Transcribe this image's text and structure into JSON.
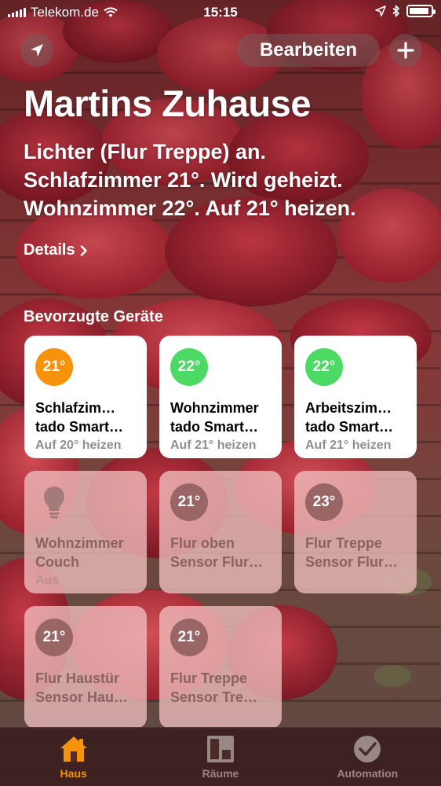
{
  "status_bar": {
    "carrier": "Telekom.de",
    "time": "15:15"
  },
  "header": {
    "edit_label": "Bearbeiten",
    "location_icon": "location-arrow-icon",
    "add_icon": "plus-icon"
  },
  "home": {
    "title": "Martins Zuhause",
    "summary": [
      "Lichter (Flur Treppe) an.",
      "Schlafzimmer 21°. Wird geheizt.",
      "Wohnzimmer 22°. Auf 21° heizen."
    ],
    "details_label": "Details"
  },
  "favorites": {
    "section_title": "Bevorzugte Geräte",
    "tiles": [
      {
        "badge": "21°",
        "name1": "Schlafzim…",
        "name2": "tado Smart…",
        "status": "Auf 20° heizen",
        "state": "on",
        "badge_color": "#f7930a"
      },
      {
        "badge": "22°",
        "name1": "Wohnzimmer",
        "name2": "tado Smart…",
        "status": "Auf 21° heizen",
        "state": "on",
        "badge_color": "#4cd964"
      },
      {
        "badge": "22°",
        "name1": "Arbeitszim…",
        "name2": "tado Smart…",
        "status": "Auf 21° heizen",
        "state": "on",
        "badge_color": "#4cd964"
      },
      {
        "icon": "lightbulb-icon",
        "name1": "Wohnzimmer",
        "name2": "Couch",
        "status": "Aus",
        "state": "off"
      },
      {
        "badge": "21°",
        "name1": "Flur oben",
        "name2": "Sensor Flur…",
        "state": "off"
      },
      {
        "badge": "23°",
        "name1": "Flur Treppe",
        "name2": "Sensor Flur…",
        "state": "off"
      },
      {
        "badge": "21°",
        "name1": "Flur Haustür",
        "name2": "Sensor Hau…",
        "state": "off"
      },
      {
        "badge": "21°",
        "name1": "Flur Treppe",
        "name2": "Sensor Tre…",
        "state": "off"
      }
    ]
  },
  "tab_bar": {
    "tabs": [
      {
        "label": "Haus",
        "icon": "house-icon",
        "active": true
      },
      {
        "label": "Räume",
        "icon": "rooms-icon",
        "active": false
      },
      {
        "label": "Automation",
        "icon": "automation-icon",
        "active": false
      }
    ]
  },
  "colors": {
    "accent": "#f7930a",
    "heating": "#f7930a",
    "idle": "#4cd964"
  }
}
